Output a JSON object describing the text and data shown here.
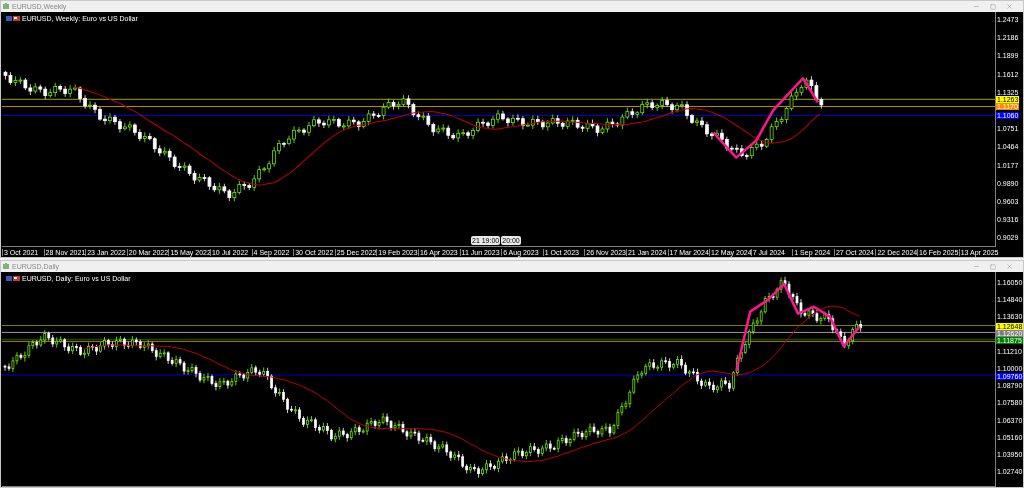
{
  "windows": [
    {
      "kind": "weekly",
      "title": "EURUSD,Weekly",
      "chart_label": "EURUSD, Weekly:  Euro vs US Dollar",
      "price_axis": [
        "1.2473",
        "1.2186",
        "1.1899",
        "1.1612",
        "1.1325",
        "1.0751",
        "1.0464",
        "1.0177",
        "0.9890",
        "0.9603",
        "0.9316",
        "0.9029"
      ],
      "price_tags": [
        {
          "text": "1.1263",
          "color": "#ffff00"
        },
        {
          "text": "1.1170",
          "color": "#ff8c00"
        },
        {
          "text": "1.1060",
          "color": "#0000ff"
        }
      ],
      "crosshair_labels": [
        "21 19:00",
        "20:00"
      ],
      "date_axis": [
        "3 Oct 2021",
        "28 Nov 2021",
        "23 Jan 2022",
        "20 Mar 2022",
        "15 May 2022",
        "10 Jul 2022",
        "4 Sep 2022",
        "30 Oct 2022",
        "25 Dec 2022",
        "19 Feb 2023",
        "16 Apr 2023",
        "11 Jun 2023",
        "6 Aug 2023",
        "1 Oct 2023",
        "26 Nov 2023",
        "21 Jan 2024",
        "17 Mar 2024",
        "12 May 2024",
        "7 Jul 2024",
        "1 Sep 2024",
        "27 Oct 2024",
        "22 Dec 2024",
        "16 Feb 2025",
        "13 Apr 2025"
      ]
    },
    {
      "kind": "daily",
      "title": "EURUSD,Daily",
      "chart_label": "EURUSD, Daily:  Euro vs US Dollar",
      "price_axis": [
        "1.16050",
        "1.14840",
        "1.13630",
        "1.11210",
        "1.10000",
        "1.08790",
        "1.07580",
        "1.06370",
        "1.05160",
        "1.03950",
        "1.02740"
      ],
      "price_tags": [
        {
          "text": "1.12648",
          "color": "#ffff00"
        },
        {
          "text": "1.12620",
          "color": "#808080"
        },
        {
          "text": "1.11875",
          "color": "#008000"
        },
        {
          "text": "1.09760",
          "color": "#0000ff"
        }
      ]
    }
  ]
}
